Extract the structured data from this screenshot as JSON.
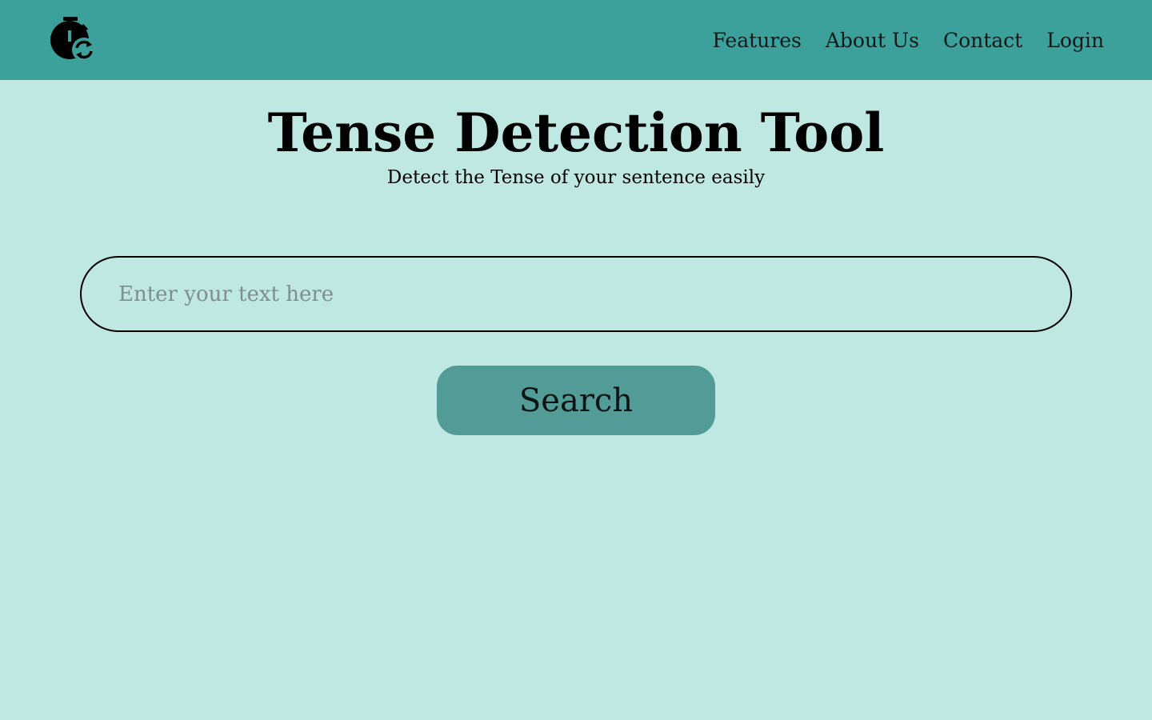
{
  "header": {
    "logo_icon": "stopwatch-sync-icon",
    "nav": [
      {
        "label": "Features"
      },
      {
        "label": "About Us"
      },
      {
        "label": "Contact"
      },
      {
        "label": "Login"
      }
    ]
  },
  "main": {
    "title": "Tense Detection Tool",
    "subtitle": "Detect the Tense of your sentence easily",
    "search": {
      "value": "",
      "placeholder": "Enter your text here",
      "button_label": "Search"
    }
  },
  "colors": {
    "background": "#bfe8e2",
    "navbar": "#3ca19a",
    "button": "#539b96",
    "text": "#000000",
    "placeholder": "#7e8f8b"
  }
}
